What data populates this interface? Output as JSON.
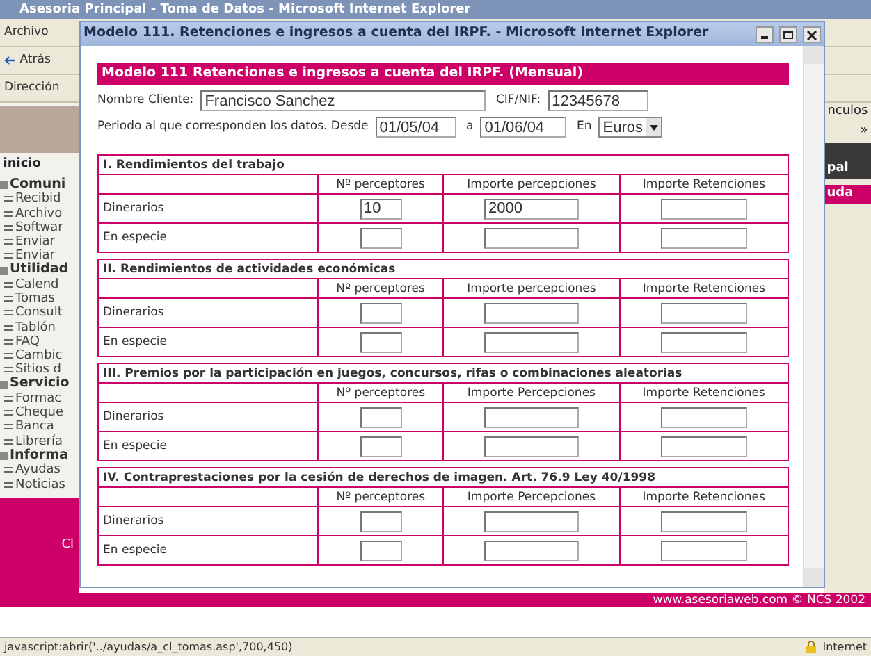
{
  "browser": {
    "title": "Asesoria Principal - Toma de Datos - Microsoft Internet Explorer",
    "menu": [
      "Archivo"
    ],
    "back_button": "Atrás",
    "address_label": "Dirección",
    "links_label": "nculos »",
    "panel_title": "pal",
    "panel_tab": "uda"
  },
  "sidebar": {
    "tab": "inicio",
    "groups": [
      {
        "label": "Comuni",
        "children": [
          {
            "label": "Recibid"
          },
          {
            "label": "Archivo"
          },
          {
            "label": "Softwar"
          },
          {
            "label": "Enviar"
          },
          {
            "label": "Enviar"
          }
        ]
      },
      {
        "label": "Utilidad",
        "children": [
          {
            "label": "Calend"
          },
          {
            "label": "Tomas"
          },
          {
            "label": "Consult"
          },
          {
            "label": "Tablón"
          },
          {
            "label": "FAQ"
          },
          {
            "label": "Cambic"
          },
          {
            "label": "Sitios d"
          }
        ]
      },
      {
        "label": "Servicio",
        "children": [
          {
            "label": "Formac"
          },
          {
            "label": "Cheque"
          },
          {
            "label": "Banca"
          },
          {
            "label": "Librería"
          }
        ]
      },
      {
        "label": "Informa",
        "children": [
          {
            "label": "Ayudas"
          },
          {
            "label": "Noticias"
          }
        ]
      }
    ],
    "promo_text": "Cl"
  },
  "popup": {
    "title": "Modelo 111. Retenciones e ingresos a cuenta del IRPF. - Microsoft Internet Explorer",
    "heading": "Modelo 111 Retenciones e ingresos a cuenta del IRPF. (Mensual)",
    "client_label": "Nombre Cliente:",
    "client_value": "Francisco Sanchez",
    "cif_label": "CIF/NIF:",
    "cif_value": "12345678",
    "period_label": "Periodo al que corresponden los datos. Desde",
    "from_value": "01/05/04",
    "to_label": "a",
    "to_value": "01/06/04",
    "currency_label": "En",
    "currency_value": "Euros",
    "sections": [
      {
        "title": "I. Rendimientos del trabajo",
        "columns": [
          "Nº perceptores",
          "Importe percepciones",
          "Importe Retenciones"
        ],
        "rows": [
          {
            "label": "Dinerarios",
            "perceptores": "10",
            "importe_percepciones": "2000"
          },
          {
            "label": "En especie"
          }
        ]
      },
      {
        "title": "II. Rendimientos de actividades económicas",
        "columns": [
          "Nº perceptores",
          "Importe percepciones",
          "Importe Retenciones"
        ],
        "rows": [
          {
            "label": "Dinerarios"
          },
          {
            "label": "En especie"
          }
        ]
      },
      {
        "title": "III. Premios por la participación en juegos, concursos, rifas o combinaciones aleatorias",
        "columns": [
          "Nº perceptores",
          "Importe Percepciones",
          "Importe Retenciones"
        ],
        "rows": [
          {
            "label": "Dinerarios"
          },
          {
            "label": "En especie"
          }
        ]
      },
      {
        "title": "IV. Contraprestaciones por la cesión de derechos de imagen. Art. 76.9 Ley 40/1998",
        "columns": [
          "Nº perceptores",
          "Importe Percepciones",
          "Importe Retenciones"
        ],
        "rows": [
          {
            "label": "Dinerarios"
          },
          {
            "label": "En especie"
          }
        ]
      }
    ]
  },
  "footer": "www.asesoriaweb.com © NCS 2002",
  "status_bar": {
    "text": "javascript:abrir('../ayudas/a_cl_tomas.asp',700,450)",
    "zone": "Internet"
  }
}
